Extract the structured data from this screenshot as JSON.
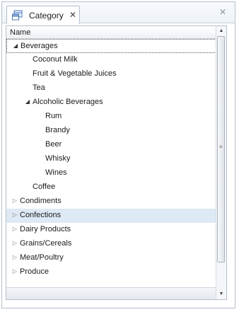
{
  "panel": {
    "tab_title": "Category",
    "tab_close_glyph": "✕",
    "panel_close_glyph": "✕",
    "tab_icon": "category-table-icon"
  },
  "grid": {
    "column_header": "Name",
    "rows": [
      {
        "label": "Beverages",
        "level": 0,
        "expander": "expanded",
        "selected": true
      },
      {
        "label": "Coconut Milk",
        "level": 1,
        "expander": "none"
      },
      {
        "label": "Fruit & Vegetable Juices",
        "level": 1,
        "expander": "none"
      },
      {
        "label": "Tea",
        "level": 1,
        "expander": "none"
      },
      {
        "label": "Alcoholic Beverages",
        "level": 1,
        "expander": "expanded"
      },
      {
        "label": "Rum",
        "level": 2,
        "expander": "none"
      },
      {
        "label": "Brandy",
        "level": 2,
        "expander": "none"
      },
      {
        "label": "Beer",
        "level": 2,
        "expander": "none"
      },
      {
        "label": "Whisky",
        "level": 2,
        "expander": "none"
      },
      {
        "label": "Wines",
        "level": 2,
        "expander": "none"
      },
      {
        "label": "Coffee",
        "level": 1,
        "expander": "none"
      },
      {
        "label": "Condiments",
        "level": 0,
        "expander": "collapsed"
      },
      {
        "label": "Confections",
        "level": 0,
        "expander": "collapsed",
        "hover": true
      },
      {
        "label": "Dairy Products",
        "level": 0,
        "expander": "collapsed"
      },
      {
        "label": "Grains/Cereals",
        "level": 0,
        "expander": "collapsed"
      },
      {
        "label": "Meat/Poultry",
        "level": 0,
        "expander": "collapsed"
      },
      {
        "label": "Produce",
        "level": 0,
        "expander": "collapsed"
      }
    ]
  },
  "scrollbar": {
    "up_glyph": "▲",
    "down_glyph": "▼",
    "grip_glyph": "≡"
  },
  "colors": {
    "hover_row": "#dde9f4",
    "border": "#b5bfcc"
  }
}
